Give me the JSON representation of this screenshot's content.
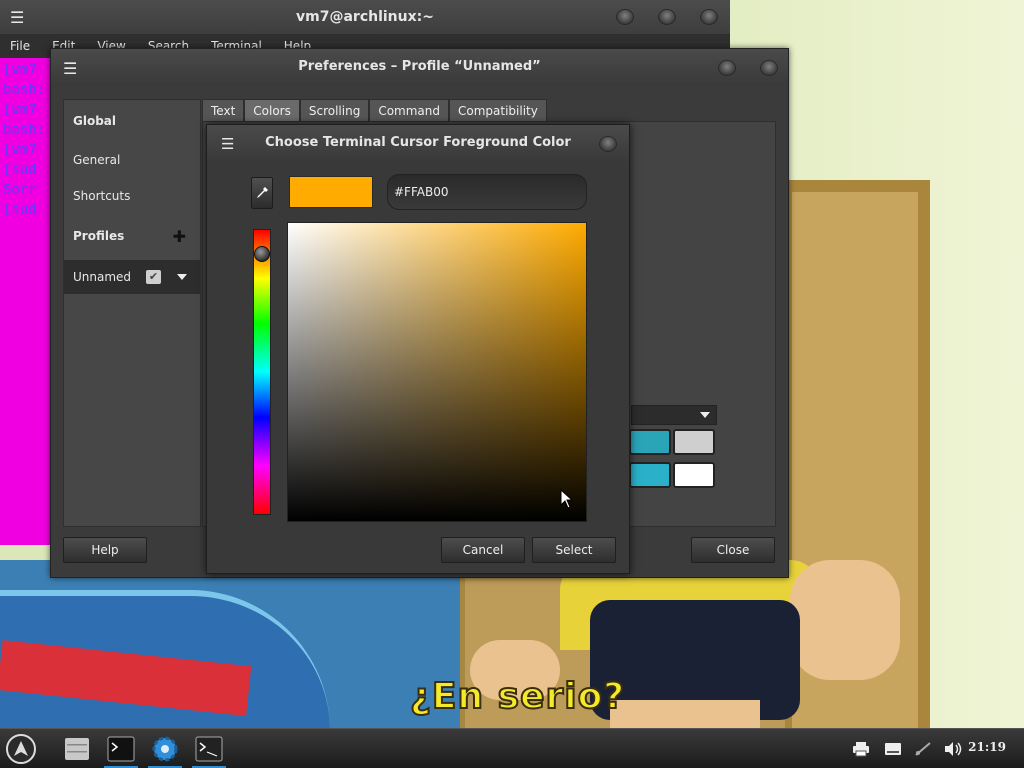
{
  "terminal": {
    "title": "vm7@archlinux:~",
    "menu": [
      "File",
      "Edit",
      "View",
      "Search",
      "Terminal",
      "Help"
    ],
    "lines": [
      "[vm7",
      "bash:",
      "[vm7",
      "bash:",
      "[vm7",
      "[sud",
      "Sorr",
      "[sud"
    ]
  },
  "prefs": {
    "title": "Preferences – Profile “Unnamed”",
    "sidebar": {
      "global": "Global",
      "general": "General",
      "shortcuts": "Shortcuts",
      "profiles": "Profiles",
      "profile_name": "Unnamed"
    },
    "tabs": [
      "Text",
      "Colors",
      "Scrolling",
      "Command",
      "Compatibility"
    ],
    "active_tab": "Colors",
    "help_label": "Help",
    "close_label": "Close",
    "swatches": [
      "#2aa5b7",
      "#cfcfcf",
      "#2ab0c9",
      "#ffffff"
    ]
  },
  "chooser": {
    "title": "Choose Terminal Cursor Foreground Color",
    "hex_value": "#FFAB00",
    "current_color": "#FFAB00",
    "hue_level_percent": 4,
    "cancel_label": "Cancel",
    "select_label": "Select"
  },
  "wallpaper": {
    "subtitle": "¿En serio?"
  },
  "taskbar": {
    "clock": "21:19"
  }
}
